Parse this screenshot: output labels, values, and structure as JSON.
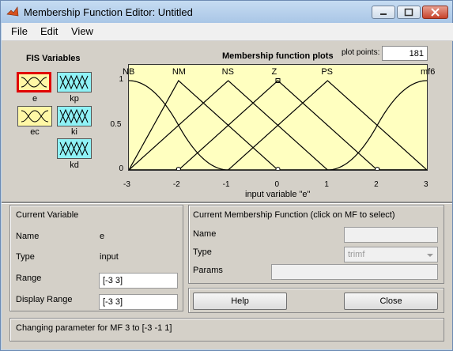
{
  "window": {
    "title": "Membership Function Editor: Untitled"
  },
  "menu": {
    "items": [
      "File",
      "Edit",
      "View"
    ]
  },
  "fis": {
    "title": "FIS Variables",
    "inputs": [
      {
        "label": "e"
      },
      {
        "label": "ec"
      }
    ],
    "outputs": [
      {
        "label": "kp"
      },
      {
        "label": "ki"
      },
      {
        "label": "kd"
      }
    ]
  },
  "plot": {
    "title": "Membership function plots",
    "plot_points_label": "plot points:",
    "plot_points_value": "181",
    "xlabel": "input variable \"e\""
  },
  "chart_data": {
    "type": "line",
    "xlabel": "input variable \"e\"",
    "xlim": [
      -3,
      3
    ],
    "ylim": [
      0,
      1
    ],
    "xticks": [
      "-3",
      "-2",
      "-1",
      "0",
      "1",
      "2",
      "3"
    ],
    "yticks": [
      "0",
      "0.5",
      "1"
    ],
    "series": [
      {
        "name": "NB",
        "kind": "zmf",
        "params": [
          -3,
          -1
        ]
      },
      {
        "name": "NM",
        "kind": "trimf",
        "params": [
          -3,
          -2,
          0
        ]
      },
      {
        "name": "NS",
        "kind": "trimf",
        "params": [
          -3,
          -1,
          1
        ]
      },
      {
        "name": "Z",
        "kind": "trimf",
        "params": [
          -2,
          0,
          2
        ]
      },
      {
        "name": "PS",
        "kind": "trimf",
        "params": [
          -1,
          1,
          3
        ]
      },
      {
        "name": "mf6",
        "kind": "smf",
        "params": [
          1,
          3
        ]
      }
    ],
    "markers": [
      -2,
      0,
      2
    ],
    "selected_series": "Z"
  },
  "current_variable": {
    "title": "Current Variable",
    "name_label": "Name",
    "name_value": "e",
    "type_label": "Type",
    "type_value": "input",
    "range_label": "Range",
    "range_value": "[-3 3]",
    "display_range_label": "Display Range",
    "display_range_value": "[-3 3]"
  },
  "current_mf": {
    "title": "Current Membership Function (click on MF to select)",
    "name_label": "Name",
    "name_value": "",
    "type_label": "Type",
    "type_value": "trimf",
    "params_label": "Params",
    "params_value": ""
  },
  "buttons": {
    "help": "Help",
    "close": "Close"
  },
  "status": "Changing parameter for MF 3 to  [-3 -1 1]"
}
